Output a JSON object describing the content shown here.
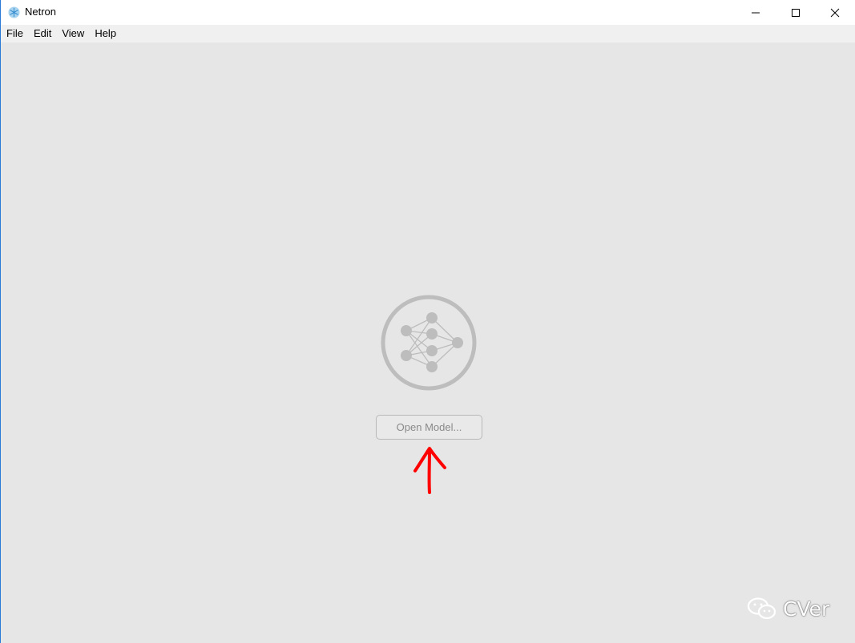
{
  "window": {
    "title": "Netron",
    "app_icon": "netron-snowflake-icon",
    "controls": [
      "minimize-icon",
      "maximize-icon",
      "close-icon"
    ]
  },
  "menubar": {
    "items": [
      {
        "label": "File"
      },
      {
        "label": "Edit"
      },
      {
        "label": "View"
      },
      {
        "label": "Help"
      }
    ]
  },
  "main": {
    "logo_icon": "neural-network-logo-icon",
    "open_model_label": "Open Model...",
    "annotation_icon": "red-arrow-up-icon"
  },
  "watermark": {
    "icon": "wechat-icon",
    "text": "CVer"
  },
  "colors": {
    "background": "#e6e6e6",
    "logo_gray": "#bdbdbd",
    "annotation_red": "#ff0000",
    "window_accent": "#2b7bd6"
  }
}
